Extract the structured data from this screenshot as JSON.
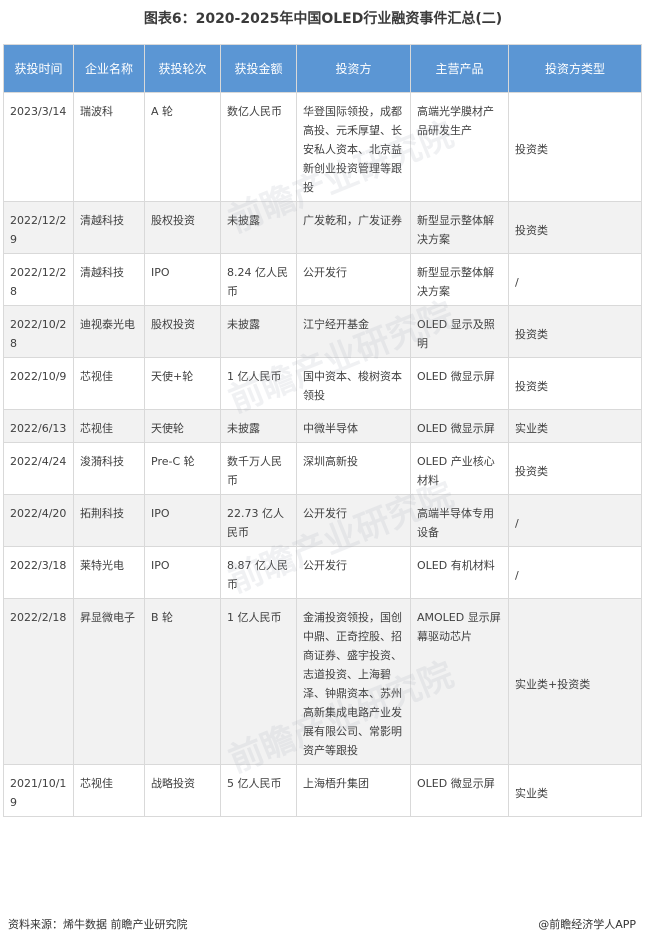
{
  "title": "图表6：2020-2025年中国OLED行业融资事件汇总(二)",
  "table": {
    "headers": [
      "获投时间",
      "企业名称",
      "获投轮次",
      "获投金额",
      "投资方",
      "主营产品",
      "投资方类型"
    ],
    "rows": [
      [
        "2023/3/14",
        "瑞波科",
        "A 轮",
        "数亿人民币",
        "华登国际领投，成都高投、元禾厚望、长安私人资本、北京益新创业投资管理等跟投",
        "高端光学膜材产品研发生产",
        "投资类"
      ],
      [
        "2022/12/29",
        "清越科技",
        "股权投资",
        "未披露",
        "广发乾和，广发证券",
        "新型显示整体解决方案",
        "投资类"
      ],
      [
        "2022/12/28",
        "清越科技",
        "IPO",
        "8.24 亿人民币",
        "公开发行",
        "新型显示整体解决方案",
        "/"
      ],
      [
        "2022/10/28",
        "迪视泰光电",
        "股权投资",
        "未披露",
        "江宁经开基金",
        "OLED 显示及照明",
        "投资类"
      ],
      [
        "2022/10/9",
        "芯视佳",
        "天使+轮",
        "1 亿人民币",
        "国中资本、梭树资本领投",
        "OLED 微显示屏",
        "投资类"
      ],
      [
        "2022/6/13",
        "芯视佳",
        "天使轮",
        "未披露",
        "中微半导体",
        "OLED 微显示屏",
        "实业类"
      ],
      [
        "2022/4/24",
        "浚漪科技",
        "Pre-C 轮",
        "数千万人民币",
        "深圳高新投",
        "OLED 产业核心材料",
        "投资类"
      ],
      [
        "2022/4/20",
        "拓荆科技",
        "IPO",
        "22.73 亿人民币",
        "公开发行",
        "高端半导体专用设备",
        "/"
      ],
      [
        "2022/3/18",
        "莱特光电",
        "IPO",
        "8.87 亿人民币",
        "公开发行",
        "OLED 有机材料",
        "/"
      ],
      [
        "2022/2/18",
        "昇显微电子",
        "B 轮",
        "1 亿人民币",
        "金浦投资领投，国创中鼎、正奇控股、招商证券、盛宇投资、志道投资、上海碧泽、钟鼎资本、苏州高新集成电路产业发展有限公司、常影明资产等跟投",
        "AMOLED 显示屏幕驱动芯片",
        "实业类+投资类"
      ],
      [
        "2021/10/19",
        "芯视佳",
        "战略投资",
        "5 亿人民币",
        "上海梧升集团",
        "OLED 微显示屏",
        "实业类"
      ]
    ]
  },
  "watermark": "前瞻产业研究院",
  "footer": {
    "source": "资料来源：烯牛数据 前瞻产业研究院",
    "brand": "@前瞻经济学人APP"
  }
}
